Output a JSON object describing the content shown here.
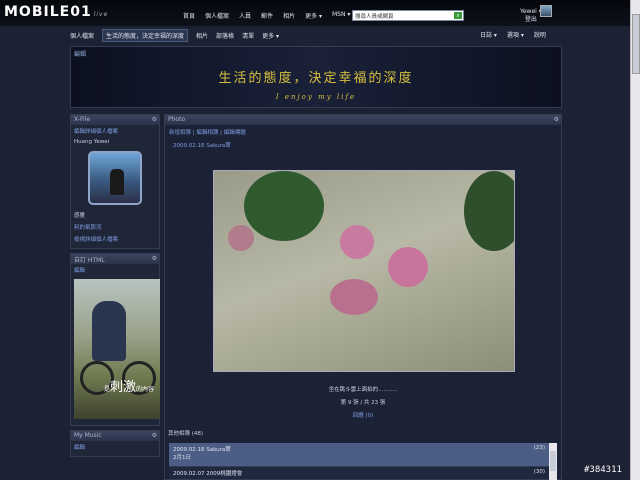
{
  "logo": {
    "text": "MOBILE01",
    "suffix": "live"
  },
  "topnav": [
    "首頁",
    "個人檔案",
    "人員",
    "郵件",
    "相片",
    "更多 ▾",
    "MSN ▾"
  ],
  "search": {
    "placeholder": "搜尋人員或網頁"
  },
  "user": {
    "name": "Yewei ▾",
    "logout": "登出"
  },
  "subnav": [
    "個人檔案",
    "生活的態度，決定幸福的深度",
    "相片",
    "部落格",
    "清單",
    "更多 ▾"
  ],
  "subright": [
    "日誌 ▾",
    "選項 ▾",
    "說明"
  ],
  "banner": {
    "edit": "編輯",
    "title": "生活的態度，決定幸福的深度",
    "subtitle": "I enjoy my life"
  },
  "xfile": {
    "title": "X-File",
    "edit_link": "編輯詳細個人檔案",
    "name": "Huang Yewei",
    "label_feel": "感覺",
    "link_feel": "利的氣那流",
    "edit_link2": "檢視詳細個人檔案"
  },
  "html_panel": {
    "title": "自訂 HTML",
    "edit": "編輯",
    "caption_small": "是",
    "caption_big": "刺激",
    "caption_tail": "的內容"
  },
  "music": {
    "title": "My Music",
    "edit": "編輯"
  },
  "photo": {
    "title": "Photo",
    "links": "新增相簿 | 編輯相簿 | 編輯標題",
    "date": "2009.02.16 Sakura翠",
    "caption": "坐在跳斗雲上面拍的...........",
    "index": "第 9 張 / 共 23 張",
    "back": "回應 (0)",
    "others_label": "其他相簿 (48)"
  },
  "albums": [
    {
      "title": "2009.02.16 Sakura翠",
      "sub": "2月1日",
      "count": "(23)"
    },
    {
      "title": "2009.02.07 2009桃園燈會",
      "sub": "",
      "count": "(30)"
    }
  ],
  "watermark": "#384311"
}
